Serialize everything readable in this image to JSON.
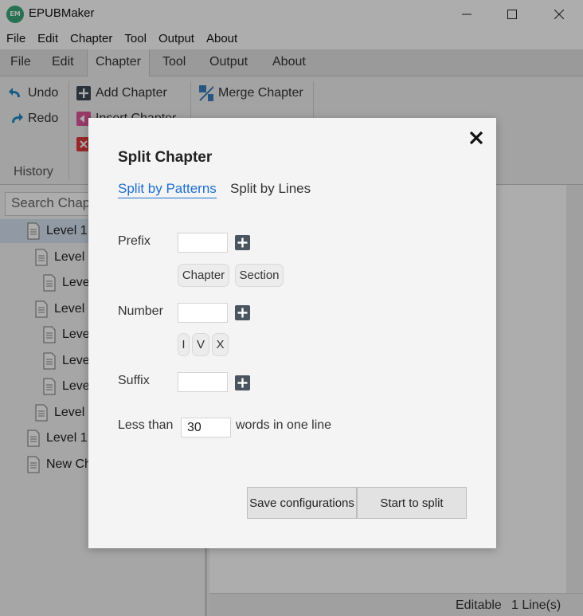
{
  "window": {
    "logo_text": "EM",
    "title": "EPUBMaker"
  },
  "menubar": {
    "items": [
      "File",
      "Edit",
      "Chapter",
      "Tool",
      "Output",
      "About"
    ]
  },
  "ribbon_tabs": {
    "items": [
      "File",
      "Edit",
      "Chapter",
      "Tool",
      "Output",
      "About"
    ],
    "active": "Chapter"
  },
  "ribbon": {
    "undo_label": "Undo",
    "redo_label": "Redo",
    "history_label": "History",
    "add_chapter_label": "Add Chapter",
    "insert_chapter_label": "Insert Chapter",
    "merge_chapter_label": "Merge Chapter"
  },
  "left_panel": {
    "search_placeholder": "Search Chapters",
    "tree": [
      {
        "label": "Level 1",
        "indent": 0,
        "selected": true
      },
      {
        "label": "Level 2",
        "indent": 1
      },
      {
        "label": "Level 3",
        "indent": 2
      },
      {
        "label": "Level 2",
        "indent": 1
      },
      {
        "label": "Level 3",
        "indent": 2
      },
      {
        "label": "Level 3",
        "indent": 2
      },
      {
        "label": "Level 3",
        "indent": 2
      },
      {
        "label": "Level 2",
        "indent": 1
      },
      {
        "label": "Level 1",
        "indent": 0
      },
      {
        "label": "New Chapter",
        "indent": 0
      }
    ]
  },
  "statusbar": {
    "mode": "Editable",
    "lines": "1 Line(s)"
  },
  "dialog": {
    "title": "Split Chapter",
    "tab_patterns": "Split by Patterns",
    "tab_lines": "Split by Lines",
    "prefix_label": "Prefix",
    "prefix_chips": [
      "Chapter",
      "Section"
    ],
    "number_label": "Number",
    "number_chips": [
      "I",
      "V",
      "X"
    ],
    "suffix_label": "Suffix",
    "less_than_label": "Less than",
    "less_than_value": "30",
    "words_label": "words in one line",
    "save_button": "Save configurations",
    "start_button": "Start to split"
  }
}
